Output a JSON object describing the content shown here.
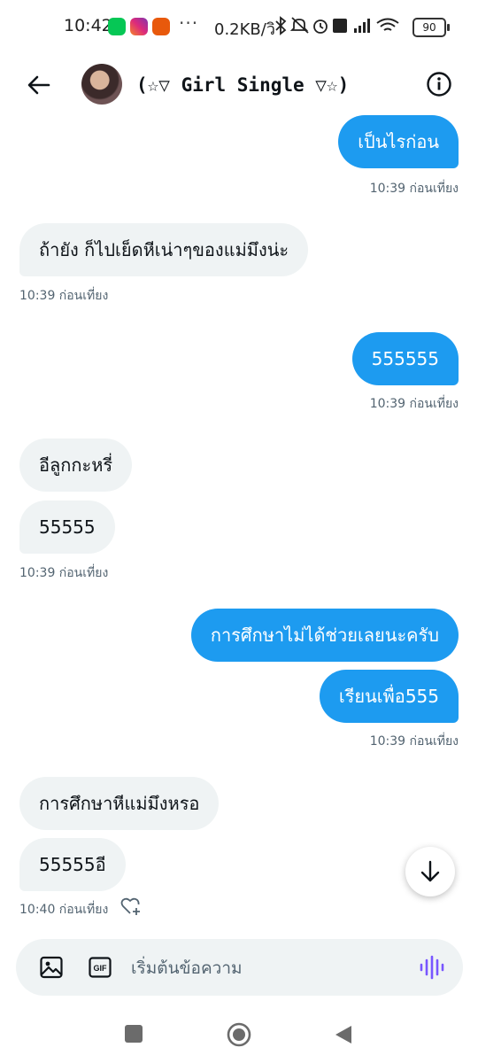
{
  "status_bar": {
    "time": "10:42",
    "net_speed": "0.2KB/วิ",
    "battery": "90",
    "dots": "···"
  },
  "header": {
    "title": "(☆▽ Girl Single ▽☆)"
  },
  "messages": [
    {
      "text": "เป็นไรก่อน"
    },
    {
      "text": "ถ้ายัง ก็ไปเย็ดหีเน่าๆของแม่มึงน่ะ"
    },
    {
      "text": "555555"
    },
    {
      "text": "อีลูกกะหรี่"
    },
    {
      "text": "55555"
    },
    {
      "text": "การศึกษาไม่ได้ช่วยเลยนะครับ"
    },
    {
      "text": "เรียนเพื่อ555"
    },
    {
      "text": "การศึกษาหีแม่มึงหรอ"
    },
    {
      "text": "55555อี"
    }
  ],
  "timestamps": {
    "t1": "10:39 ก่อนเที่ยง",
    "t2": "10:39 ก่อนเที่ยง",
    "t3": "10:39 ก่อนเที่ยง",
    "t4": "10:39 ก่อนเที่ยง",
    "t5": "10:39 ก่อนเที่ยง",
    "t6": "10:40 ก่อนเที่ยง"
  },
  "composer": {
    "placeholder": "เริ่มต้นข้อความ",
    "gif_label": "GIF"
  },
  "colors": {
    "accent": "#1d9bf0",
    "incoming_bubble": "#eff3f4",
    "voice_icon": "#7856ff"
  }
}
